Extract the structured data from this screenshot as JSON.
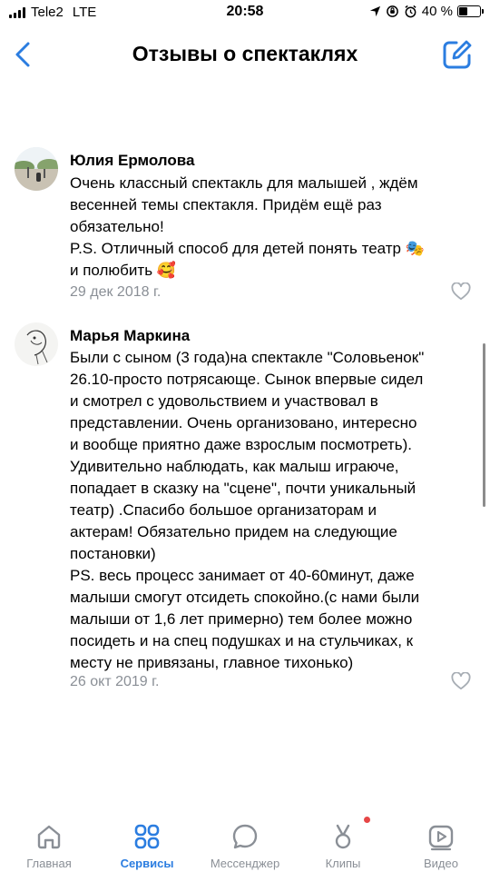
{
  "status_bar": {
    "carrier": "Tele2",
    "network": "LTE",
    "time": "20:58",
    "battery": "40 %",
    "battery_level": 0.4
  },
  "header": {
    "title": "Отзывы о спектаклях"
  },
  "comments": [
    {
      "author": "Юлия Ермолова",
      "text": "Очень классный спектакль для малышей , ждём\nвесенней темы спектакля. Придём ещё раз\nобязательно!\nP.S. Отличный способ для детей понять театр 🎭\nи полюбить 🥰",
      "date": "29 дек 2018 г."
    },
    {
      "author": "Марья Маркина",
      "text": "Были с сыном (3 года)на спектакле \"Соловьенок\"\n26.10-просто потрясающе. Сынок впервые сидел\nи смотрел с удовольствием и участвовал в\nпредставлении. Очень организовано, интересно\nи вообще приятно даже взрослым посмотреть).\nУдивительно наблюдать, как малыш играюче,\nпопадает в сказку на \"сцене\", почти уникальный\nтеатр) .Спасибо большое организаторам и\nактерам! Обязательно придем на следующие\nпостановки)\nPS. весь процесс занимает от 40-60минут, даже\nмалыши смогут отсидеть спокойно.(с нами были\nмалыши от 1,6 лет примерно) тем более можно\nпосидеть и на спец подушках и на стульчиках, к\nместу не привязаны, главное тихонько)",
      "date": "26 окт 2019 г."
    }
  ],
  "tab_bar": {
    "tabs": [
      {
        "label": "Главная",
        "icon": "home-icon"
      },
      {
        "label": "Сервисы",
        "icon": "services-icon",
        "active": true
      },
      {
        "label": "Мессенджер",
        "icon": "messenger-icon"
      },
      {
        "label": "Клипы",
        "icon": "clips-icon",
        "badge": true
      },
      {
        "label": "Видео",
        "icon": "video-icon"
      }
    ]
  },
  "colors": {
    "accent": "#2b7de0",
    "inactive": "#8a8f96",
    "badge": "#e64646"
  }
}
